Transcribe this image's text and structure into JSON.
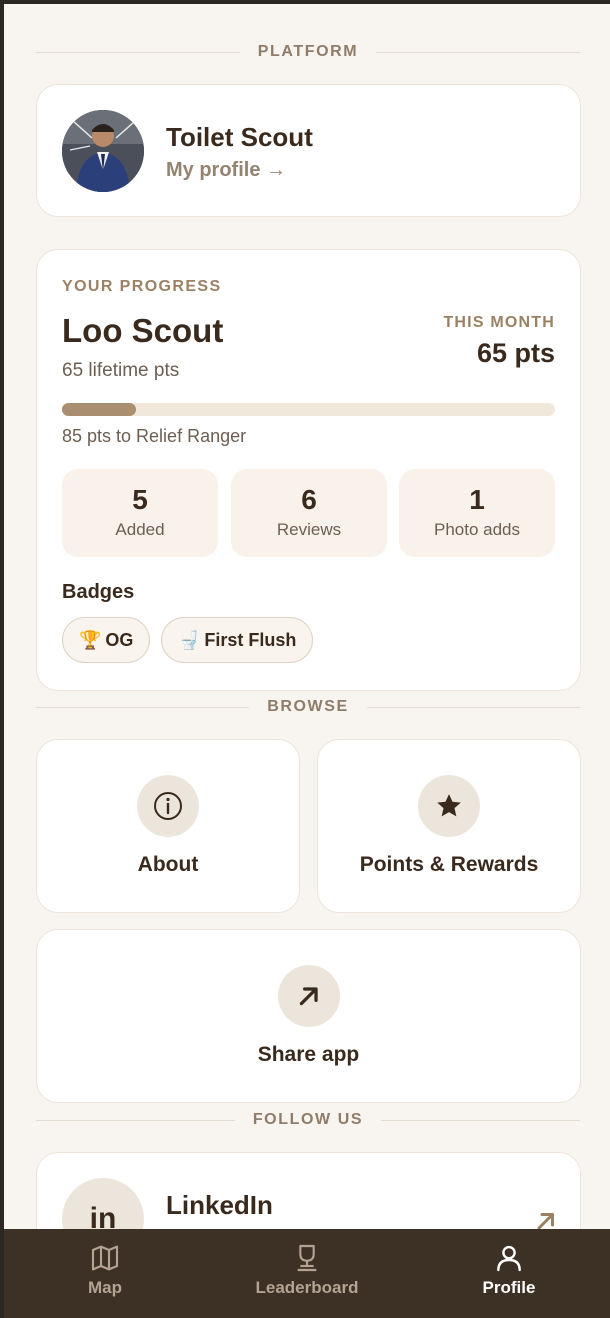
{
  "sections": {
    "platform": "PLATFORM",
    "browse": "BROWSE",
    "follow": "FOLLOW US"
  },
  "profile": {
    "name": "Toilet Scout",
    "link_label": "My profile →"
  },
  "progress": {
    "heading": "YOUR PROGRESS",
    "level": "Loo Scout",
    "lifetime": "65 lifetime pts",
    "month_label": "THIS MONTH",
    "month_pts": "65 pts",
    "progress_fraction": 0.15,
    "next_level": "85 pts to Relief Ranger",
    "stats": [
      {
        "value": "5",
        "label": "Added"
      },
      {
        "value": "6",
        "label": "Reviews"
      },
      {
        "value": "1",
        "label": "Photo adds"
      }
    ],
    "badges_title": "Badges",
    "badges": [
      {
        "emoji": "🏆",
        "label": "OG"
      },
      {
        "emoji": "🚽",
        "label": "First Flush"
      }
    ]
  },
  "browse": {
    "about": {
      "label": "About",
      "icon": "info-icon"
    },
    "points": {
      "label": "Points & Rewards",
      "icon": "star-icon"
    },
    "share": {
      "label": "Share app",
      "icon": "arrow-up-right-icon"
    }
  },
  "follow": {
    "linkedin_title": "LinkedIn",
    "linkedin_icon_text": "in"
  },
  "nav": {
    "items": [
      {
        "label": "Map",
        "icon": "map-icon",
        "active": false
      },
      {
        "label": "Leaderboard",
        "icon": "trophy-icon",
        "active": false
      },
      {
        "label": "Profile",
        "icon": "user-icon",
        "active": true
      }
    ]
  },
  "colors": {
    "background": "#f8f4ef",
    "accent": "#9b8163",
    "text_dark": "#3a2a1e",
    "nav_bg": "#3d3024"
  }
}
